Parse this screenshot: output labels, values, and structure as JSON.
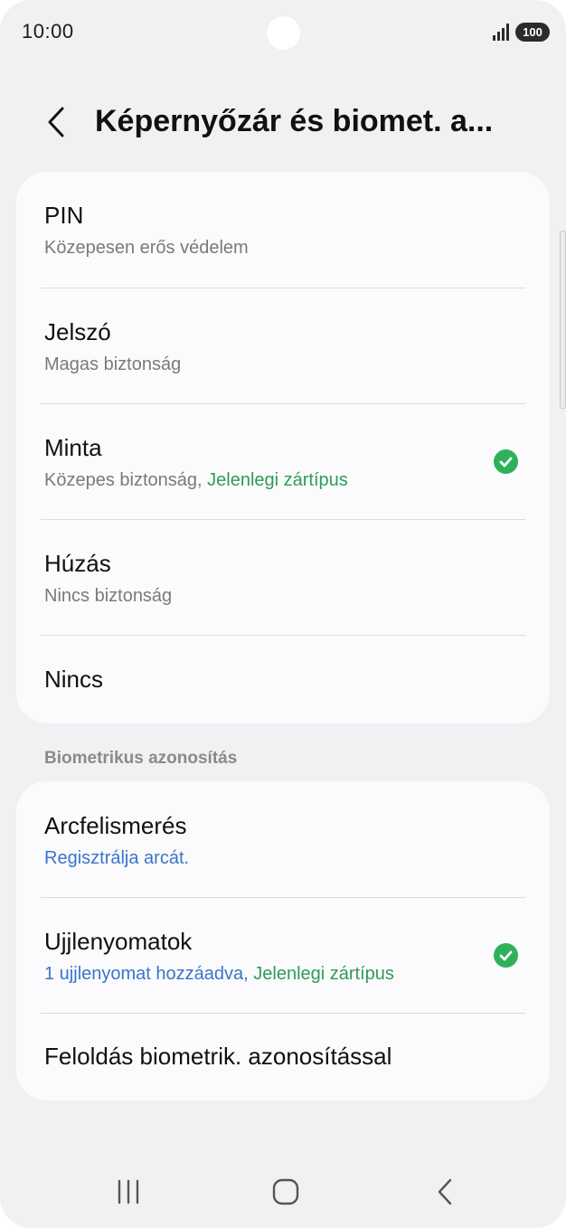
{
  "status_bar": {
    "time": "10:00",
    "battery": "100",
    "signal_icon": "signal-bars-icon"
  },
  "header": {
    "back_icon": "chevron-left-icon",
    "title": "Képernyőzár és biomet. a..."
  },
  "lock_types": [
    {
      "title": "PIN",
      "subtitle": "Közepesen erős védelem"
    },
    {
      "title": "Jelszó",
      "subtitle": "Magas biztonság"
    },
    {
      "title": "Minta",
      "subtitle": "Közepes biztonság, ",
      "subtitle_status": "Jelenlegi zártípus",
      "checked": true
    },
    {
      "title": "Húzás",
      "subtitle": "Nincs biztonság"
    },
    {
      "title": "Nincs"
    }
  ],
  "biometrics": {
    "section_title": "Biometrikus azonosítás",
    "items": [
      {
        "title": "Arcfelismerés",
        "subtitle": "Regisztrálja arcát."
      },
      {
        "title": "Ujjlenyomatok",
        "subtitle": "1 ujjlenyomat hozzáadva, ",
        "subtitle_status": "Jelenlegi zártípus",
        "checked": true
      },
      {
        "title": "Feloldás biometrik. azonosítással"
      }
    ]
  },
  "nav_bar": {
    "recents_icon": "recents-icon",
    "home_icon": "home-icon",
    "back_icon": "back-icon"
  },
  "colors": {
    "accent_green": "#2e9c55",
    "link_blue": "#3a74c9",
    "background": "#f1f1f4",
    "card": "#fbfbfd"
  }
}
